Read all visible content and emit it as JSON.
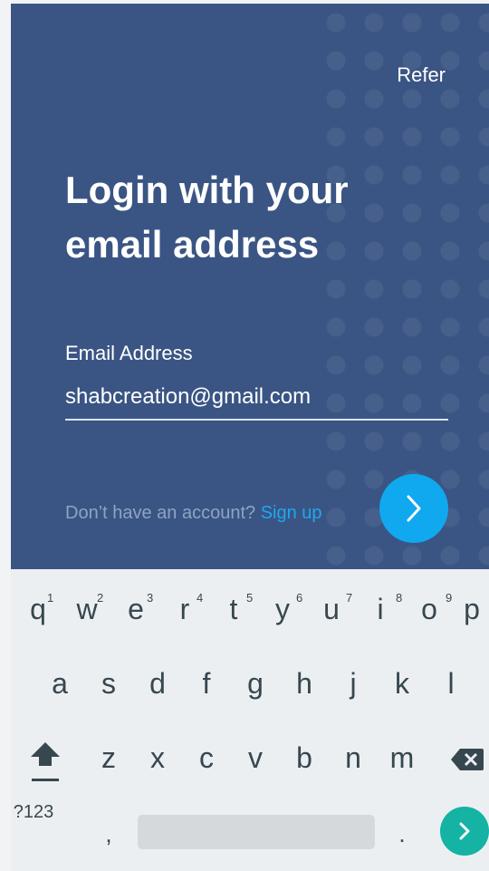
{
  "header": {
    "refer_label": "Refer"
  },
  "login": {
    "title": "Login with your email address",
    "email_label": "Email Address",
    "email_value": "shabcreation@gmail.com",
    "signup_prompt": "Don’t have an account?",
    "signup_link": "Sign up"
  },
  "keyboard": {
    "row1": [
      {
        "key": "q",
        "hint": "1"
      },
      {
        "key": "w",
        "hint": "2"
      },
      {
        "key": "e",
        "hint": "3"
      },
      {
        "key": "r",
        "hint": "4"
      },
      {
        "key": "t",
        "hint": "5"
      },
      {
        "key": "y",
        "hint": "6"
      },
      {
        "key": "u",
        "hint": "7"
      },
      {
        "key": "i",
        "hint": "8"
      },
      {
        "key": "o",
        "hint": "9"
      },
      {
        "key": "p",
        "hint": ""
      }
    ],
    "row2": [
      "a",
      "s",
      "d",
      "f",
      "g",
      "h",
      "j",
      "k",
      "l"
    ],
    "row3": [
      "z",
      "x",
      "c",
      "v",
      "b",
      "n",
      "m"
    ],
    "symbols_label": "?123",
    "comma_label": ",",
    "period_label": "."
  },
  "colors": {
    "app_background": "#3a5584",
    "accent_blue": "#10a8ef",
    "enter_key": "#14b3a4",
    "keyboard_background": "#eceff1"
  },
  "icons": {
    "next": "chevron-right-icon",
    "shift": "shift-arrow-icon",
    "backspace": "backspace-icon",
    "enter": "chevron-right-icon"
  }
}
